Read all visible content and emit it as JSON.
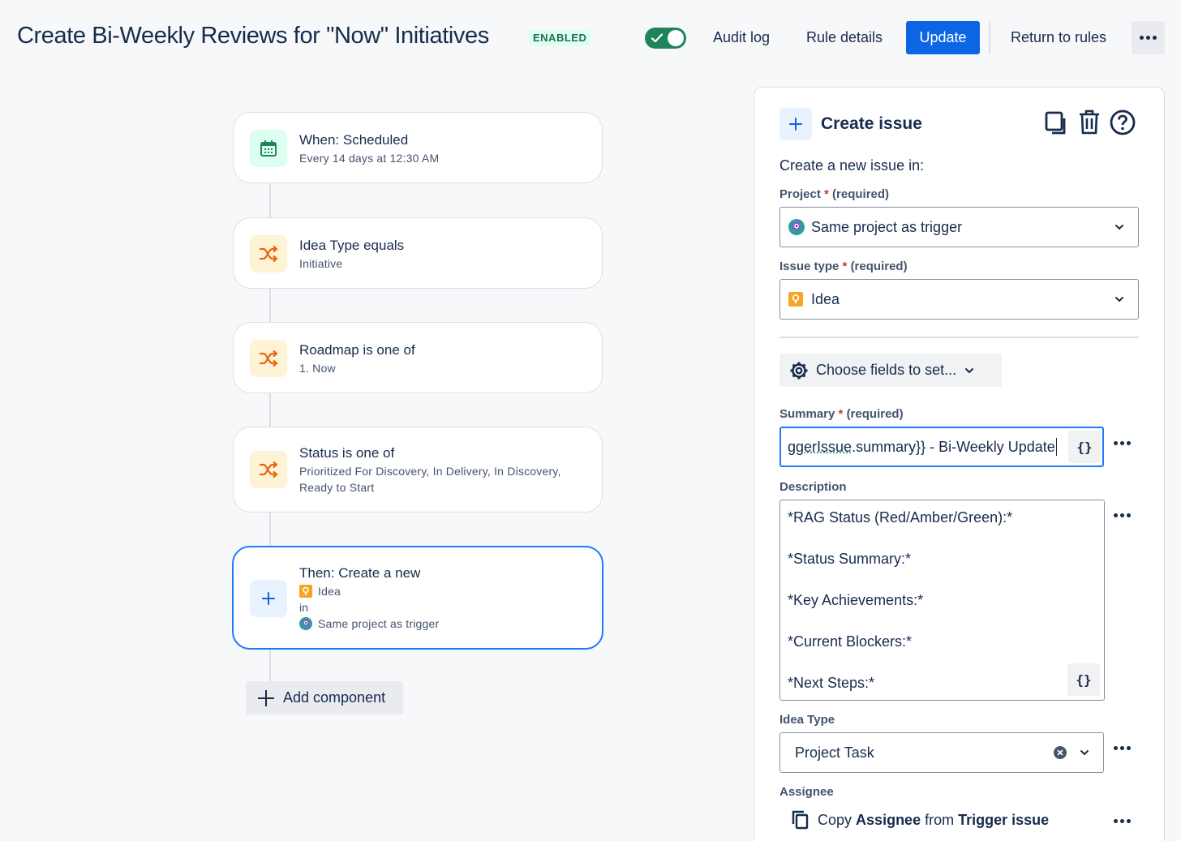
{
  "header": {
    "title": "Create Bi-Weekly Reviews for \"Now\" Initiatives",
    "status_badge": "ENABLED",
    "toggle_on": true,
    "audit_log": "Audit log",
    "rule_details": "Rule details",
    "update": "Update",
    "return_to_rules": "Return to rules",
    "more_icon": "more-horizontal-icon"
  },
  "flow": {
    "components": [
      {
        "title": "When: Scheduled",
        "subtitle": "Every 14 days at 12:30 AM",
        "icon": "calendar-icon",
        "color": "#1f845a"
      },
      {
        "title": "Idea Type equals",
        "subtitle": "Initiative",
        "icon": "branch-shuffle-icon",
        "color": "#e56910"
      },
      {
        "title": "Roadmap is one of",
        "subtitle": "1. Now",
        "icon": "branch-shuffle-icon",
        "color": "#e56910"
      },
      {
        "title": "Status is one of",
        "subtitle": "Prioritized For Discovery, In Delivery, In Discovery, Ready to Start",
        "icon": "branch-shuffle-icon",
        "color": "#e56910"
      },
      {
        "title": "Then: Create a new",
        "issue_type": "Idea",
        "in": "in",
        "project": "Same project as trigger",
        "icon": "plus-icon",
        "color": "#0c66e4"
      }
    ],
    "add_component": "Add component"
  },
  "panel": {
    "title": "Create issue",
    "intro": "Create a new issue in:",
    "project": {
      "label": "Project",
      "required_mark": "*",
      "required_text": "(required)",
      "value": "Same project as trigger"
    },
    "issue_type": {
      "label": "Issue type",
      "required_mark": "*",
      "required_text": "(required)",
      "value": "Idea"
    },
    "choose_fields": "Choose fields to set...",
    "summary": {
      "label": "Summary",
      "required_mark": "*",
      "required_text": "(required)",
      "value_prefix": "ggerIssue",
      "value_rest": ".summary}} - Bi-Weekly Update",
      "smart_value_button": "{}"
    },
    "description": {
      "label": "Description",
      "lines": [
        "*RAG Status (Red/Amber/Green):*",
        "*Status Summary:*",
        "*Key Achievements:*",
        "*Current Blockers:*",
        "*Next Steps:*"
      ],
      "smart_value_button": "{}"
    },
    "idea_type": {
      "label": "Idea Type",
      "value": "Project Task"
    },
    "assignee": {
      "label": "Assignee",
      "copy": "Copy",
      "field": "Assignee",
      "from": "from",
      "source": "Trigger issue"
    }
  }
}
